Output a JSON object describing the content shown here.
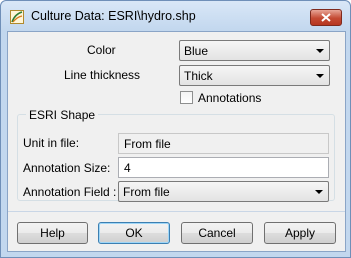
{
  "window": {
    "title": "Culture Data: ESRI\\hydro.shp",
    "close_label": "×"
  },
  "display": {
    "color_label": "Color",
    "color_value": "Blue",
    "thickness_label": "Line thickness",
    "thickness_value": "Thick",
    "annotations_label": "Annotations",
    "annotations_checked": false
  },
  "esri": {
    "group_label": "ESRI Shape",
    "unit_label": "Unit in file:",
    "unit_value": "From file",
    "annotation_size_label": "Annotation Size:",
    "annotation_size_value": "4",
    "annotation_field_label": "Annotation Field :",
    "annotation_field_value": "From file"
  },
  "buttons": {
    "help": "Help",
    "ok": "OK",
    "cancel": "Cancel",
    "apply": "Apply"
  },
  "icons": {
    "app": "culture-data-icon",
    "close": "close-icon",
    "dropdown": "chevron-down-icon"
  }
}
